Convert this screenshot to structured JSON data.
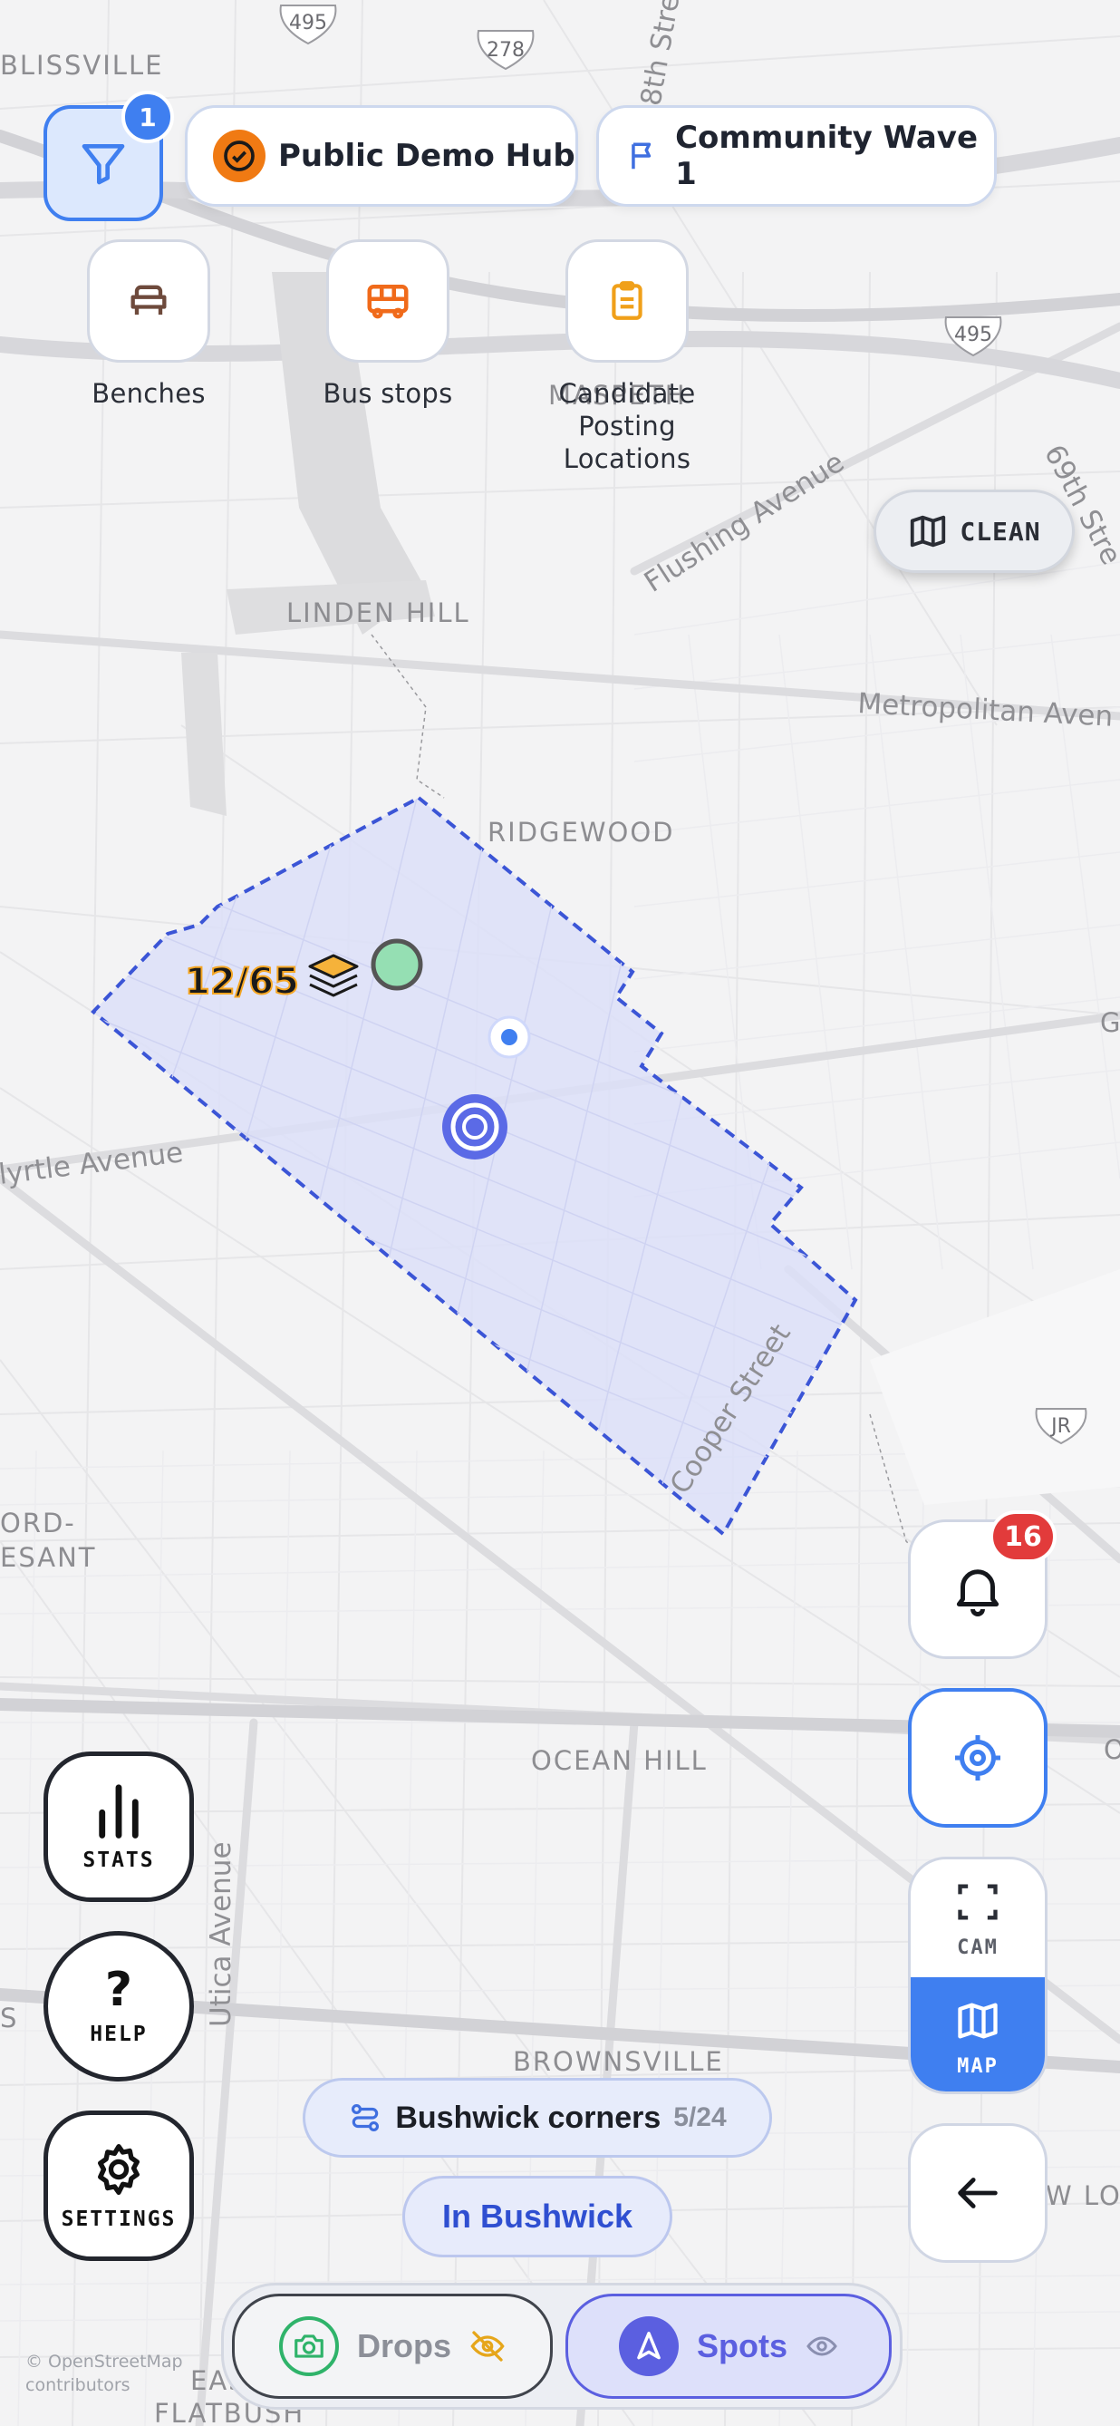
{
  "colors": {
    "accent_blue": "#3f7ff0",
    "zone_fill": "#d9dcf7",
    "zone_border": "#3b55d6",
    "badge_red": "#e23b3b",
    "hub_orange": "#f07a13",
    "spots_purple": "#5b5fe0"
  },
  "map": {
    "labels": {
      "blissville": "BLISSVILLE",
      "maspeth": "MASPETH",
      "linden_hill": "LINDEN HILL",
      "ridgewood": "RIDGEWOOD",
      "ocean_hill": "OCEAN HILL",
      "brownsville": "BROWNSVILLE",
      "ord_esant": "ORD-\nESANT",
      "east_flatbush": "EAST\nFLATBUSH",
      "new_lo": "NEW LO",
      "g_cut": "G",
      "o_cut": "O",
      "s_cut": "S",
      "flushing_ave": "Flushing Avenue",
      "metropolitan_ave": "Metropolitan Aven",
      "myrtle_ave": "lyrtle Avenue",
      "cooper_st": "Cooper Street",
      "utica_ave": "Utica Avenue",
      "st_69": "69th Stre",
      "st_58": "8th Stre"
    },
    "shields": {
      "i495_top": "495",
      "i278": "278",
      "i495_right": "495",
      "jr": "JR"
    },
    "attribution": "© OpenStreetMap\ncontributors"
  },
  "filter": {
    "badge_count": "1",
    "icon": "filter-icon"
  },
  "hub": {
    "label": "Public Demo Hub",
    "icon": "check-circle-icon"
  },
  "wave": {
    "label": "Community Wave 1",
    "icon": "flag-icon"
  },
  "layers": [
    {
      "label": "Benches",
      "icon": "bench-icon"
    },
    {
      "label": "Bus stops",
      "icon": "bus-icon"
    },
    {
      "label": "Candidate\nPosting\nLocations",
      "icon": "clipboard-icon"
    }
  ],
  "clean_button": {
    "label": "CLEAN",
    "icon": "map-icon"
  },
  "cluster": {
    "count": "12/65",
    "icon": "layers-icon"
  },
  "notifications": {
    "count": "16"
  },
  "camera_toggle": {
    "cam_label": "CAM",
    "map_label": "MAP",
    "active": "MAP"
  },
  "side_buttons": {
    "stats": "STATS",
    "help": "HELP",
    "settings": "SETTINGS"
  },
  "route_pill": {
    "label": "Bushwick corners",
    "progress": "5/24"
  },
  "zone_pill": {
    "label": "In Bushwick"
  },
  "bottom_tabs": {
    "drops": "Drops",
    "spots": "Spots",
    "active": "Spots"
  }
}
